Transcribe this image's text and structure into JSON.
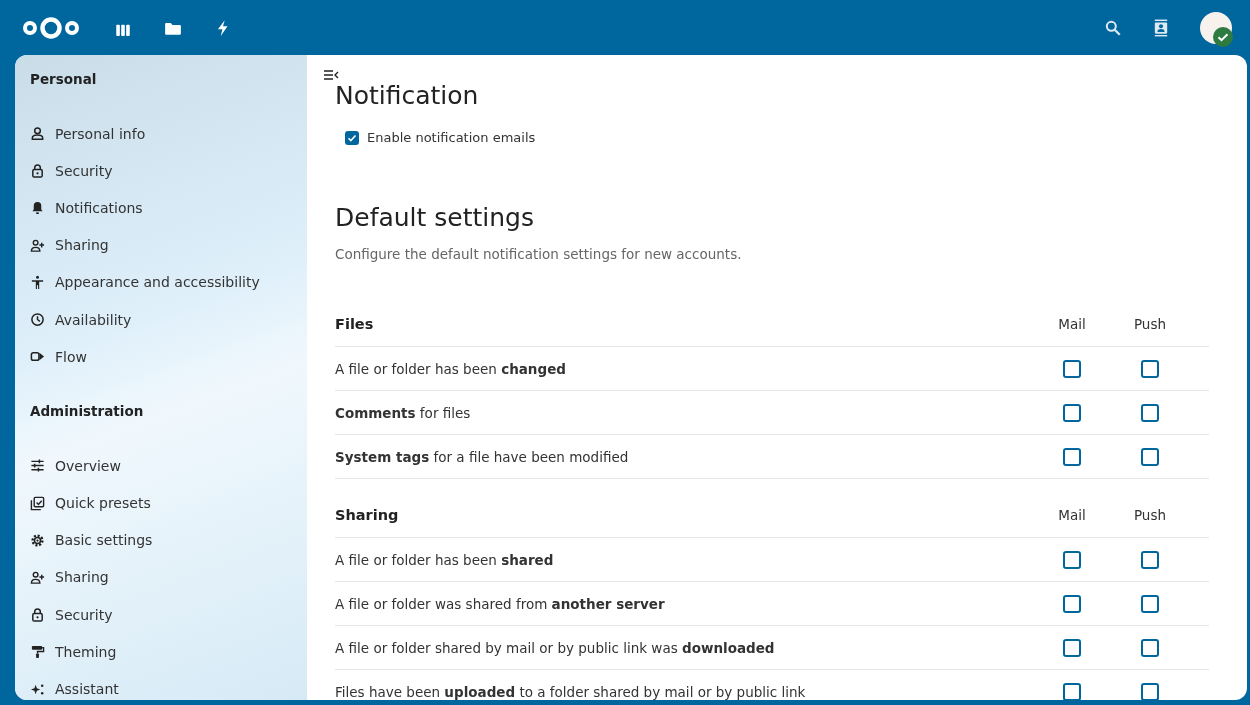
{
  "sidebar": {
    "sections": [
      {
        "title": "Personal",
        "items": [
          {
            "label": "Personal info"
          },
          {
            "label": "Security"
          },
          {
            "label": "Notifications"
          },
          {
            "label": "Sharing"
          },
          {
            "label": "Appearance and accessibility"
          },
          {
            "label": "Availability"
          },
          {
            "label": "Flow"
          }
        ]
      },
      {
        "title": "Administration",
        "items": [
          {
            "label": "Overview"
          },
          {
            "label": "Quick presets"
          },
          {
            "label": "Basic settings"
          },
          {
            "label": "Sharing"
          },
          {
            "label": "Security"
          },
          {
            "label": "Theming"
          },
          {
            "label": "Assistant"
          }
        ]
      }
    ]
  },
  "main": {
    "title": "Notification",
    "enable_emails": {
      "label": "Enable notification emails",
      "checked": true
    },
    "defaults_title": "Default settings",
    "defaults_description": "Configure the default notification settings for new accounts.",
    "groups": [
      {
        "title": "Files",
        "column_mail": "Mail",
        "column_push": "Push",
        "rows": [
          {
            "label": "A file or folder has been **changed**",
            "mail": false,
            "push": false
          },
          {
            "label": "**Comments** for files",
            "mail": false,
            "push": false
          },
          {
            "label": "**System tags** for a file have been modified",
            "mail": false,
            "push": false
          }
        ]
      },
      {
        "title": "Sharing",
        "column_mail": "Mail",
        "column_push": "Push",
        "rows": [
          {
            "label": "A file or folder has been **shared**",
            "mail": false,
            "push": false
          },
          {
            "label": "A file or folder was shared from **another server**",
            "mail": false,
            "push": false
          },
          {
            "label": "A file or folder shared by mail or by public link was **downloaded**",
            "mail": false,
            "push": false
          },
          {
            "label": "Files have been **uploaded** to a folder shared by mail or by public link",
            "mail": false,
            "push": false
          }
        ]
      }
    ]
  }
}
